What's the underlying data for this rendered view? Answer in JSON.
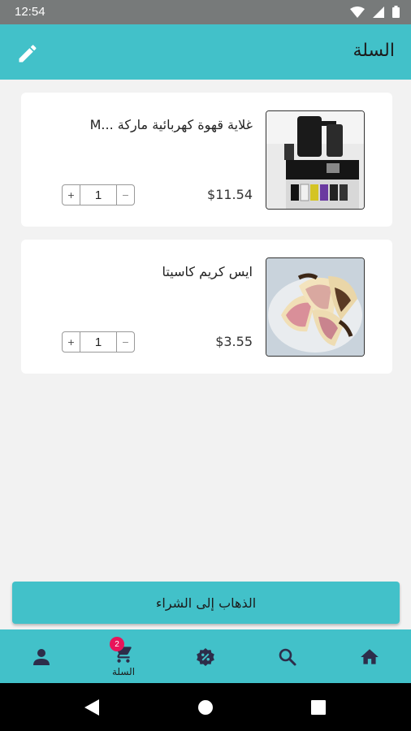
{
  "status_bar": {
    "time": "12:54"
  },
  "app_bar": {
    "title": "السلة"
  },
  "cart_items": [
    {
      "name": "غلاية قهوة كهربائية ماركة ...M",
      "price": "$11.54",
      "quantity": "1",
      "plus": "+",
      "minus": "−"
    },
    {
      "name": "ايس كريم كاسيتا",
      "price": "$3.55",
      "quantity": "1",
      "plus": "+",
      "minus": "−"
    }
  ],
  "checkout_button": {
    "label": "الذهاب إلى الشراء"
  },
  "bottom_nav": {
    "cart_label": "السلة",
    "cart_badge": "2"
  },
  "colors": {
    "accent": "#42c1c9",
    "badge": "#e8145a"
  }
}
